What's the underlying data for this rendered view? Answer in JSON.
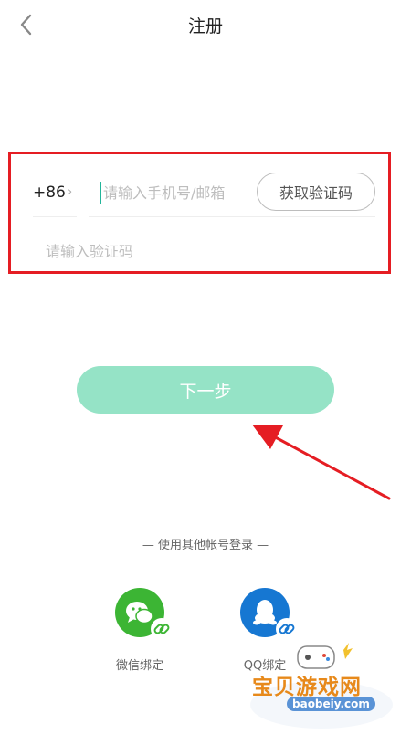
{
  "header": {
    "title": "注册",
    "back_icon": "chevron-left-icon"
  },
  "form": {
    "country_code": "+86",
    "country_chevron": "›",
    "phone_placeholder": "请输入手机号/邮箱",
    "get_code_label": "获取验证码",
    "verify_placeholder": "请输入验证码"
  },
  "next_button": {
    "label": "下一步"
  },
  "other_login": {
    "title": "— 使用其他帐号登录 —",
    "options": [
      {
        "label": "微信绑定",
        "icon": "wechat-icon",
        "color": "#3cb534"
      },
      {
        "label": "QQ绑定",
        "icon": "qq-icon",
        "color": "#1677d2"
      }
    ]
  },
  "colors": {
    "accent": "#95e3c6",
    "highlight": "#e51d23",
    "cursor": "#22b59a"
  },
  "watermark": {
    "text": "宝贝游戏网",
    "url": "baobeiy.com"
  }
}
